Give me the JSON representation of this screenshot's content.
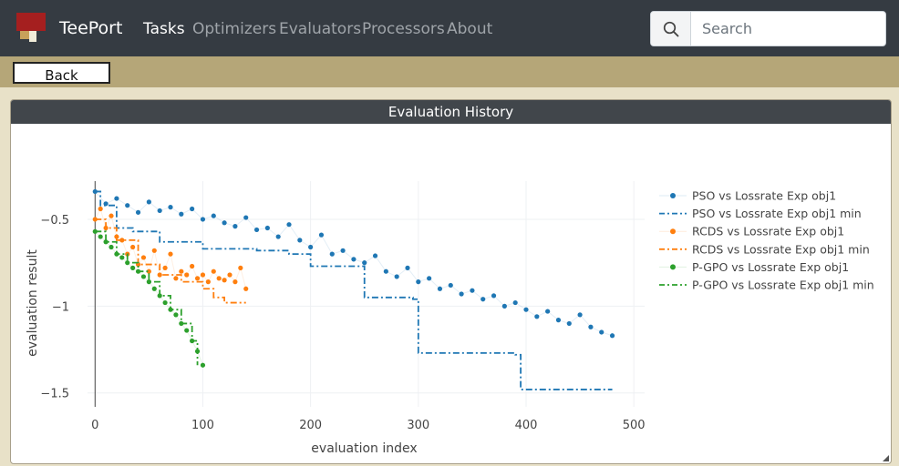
{
  "brand": "TeePort",
  "nav": [
    {
      "label": "Tasks",
      "active": true
    },
    {
      "label": "Optimizers",
      "active": false
    },
    {
      "label": "Evaluators",
      "active": false
    },
    {
      "label": "Processors",
      "active": false
    },
    {
      "label": "About",
      "active": false
    }
  ],
  "search": {
    "placeholder": "Search",
    "icon": "search-icon"
  },
  "back_button": {
    "label": "Back"
  },
  "panel": {
    "title": "Evaluation History"
  },
  "colors": {
    "navbar": "#353b42",
    "accent_strip": "#b5a678",
    "pso": "#1f77b4",
    "rcds": "#ff7f0e",
    "pgpo": "#2ca02c"
  },
  "chart_data": {
    "type": "scatter",
    "xlabel": "evaluation index",
    "ylabel": "evaluation result",
    "xlim": [
      -7,
      510
    ],
    "ylim": [
      -1.58,
      -0.28
    ],
    "x_ticks": [
      0,
      100,
      200,
      300,
      400,
      500
    ],
    "y_ticks": [
      -0.5,
      -1,
      -1.5
    ],
    "x_tick_labels": [
      "0",
      "100",
      "200",
      "300",
      "400",
      "500"
    ],
    "y_tick_labels": [
      "−0.5",
      "−1",
      "−1.5"
    ],
    "grid": true,
    "legend_position": "right",
    "series": [
      {
        "name": "PSO vs Lossrate Exp obj1",
        "style": "markers",
        "color": "#1f77b4",
        "x": [
          0,
          10,
          20,
          30,
          40,
          50,
          60,
          70,
          80,
          90,
          100,
          110,
          120,
          130,
          140,
          150,
          160,
          170,
          180,
          190,
          200,
          210,
          220,
          230,
          240,
          250,
          260,
          270,
          280,
          290,
          300,
          310,
          320,
          330,
          340,
          350,
          360,
          370,
          380,
          390,
          400,
          410,
          420,
          430,
          440,
          450,
          460,
          470,
          480
        ],
        "y": [
          -0.34,
          -0.41,
          -0.38,
          -0.42,
          -0.46,
          -0.4,
          -0.45,
          -0.43,
          -0.47,
          -0.44,
          -0.5,
          -0.48,
          -0.52,
          -0.54,
          -0.49,
          -0.56,
          -0.55,
          -0.6,
          -0.53,
          -0.62,
          -0.66,
          -0.59,
          -0.7,
          -0.68,
          -0.73,
          -0.75,
          -0.71,
          -0.8,
          -0.83,
          -0.78,
          -0.86,
          -0.84,
          -0.9,
          -0.88,
          -0.93,
          -0.91,
          -0.96,
          -0.94,
          -1.0,
          -0.98,
          -1.02,
          -1.06,
          -1.03,
          -1.08,
          -1.1,
          -1.05,
          -1.12,
          -1.15,
          -1.17
        ]
      },
      {
        "name": "PSO vs Lossrate Exp obj1 min",
        "style": "dash-dot-step",
        "color": "#1f77b4",
        "x": [
          0,
          5,
          20,
          35,
          60,
          100,
          150,
          180,
          200,
          250,
          295,
          300,
          390,
          395,
          480
        ],
        "y": [
          -0.34,
          -0.42,
          -0.55,
          -0.57,
          -0.63,
          -0.67,
          -0.68,
          -0.7,
          -0.77,
          -0.95,
          -0.96,
          -1.27,
          -1.28,
          -1.48,
          -1.48
        ]
      },
      {
        "name": "RCDS vs Lossrate Exp obj1",
        "style": "markers",
        "color": "#ff7f0e",
        "x": [
          0,
          5,
          10,
          15,
          20,
          25,
          30,
          35,
          40,
          45,
          50,
          55,
          60,
          65,
          70,
          75,
          80,
          85,
          90,
          95,
          100,
          105,
          110,
          115,
          120,
          125,
          130,
          135,
          140
        ],
        "y": [
          -0.5,
          -0.44,
          -0.55,
          -0.48,
          -0.6,
          -0.62,
          -0.7,
          -0.66,
          -0.76,
          -0.72,
          -0.8,
          -0.68,
          -0.82,
          -0.78,
          -0.7,
          -0.84,
          -0.8,
          -0.82,
          -0.77,
          -0.84,
          -0.82,
          -0.86,
          -0.8,
          -0.84,
          -0.85,
          -0.82,
          -0.86,
          -0.78,
          -0.9
        ]
      },
      {
        "name": "RCDS vs Lossrate Exp obj1 min",
        "style": "dash-dot-step",
        "color": "#ff7f0e",
        "x": [
          0,
          10,
          20,
          40,
          60,
          80,
          100,
          110,
          120,
          140
        ],
        "y": [
          -0.5,
          -0.55,
          -0.62,
          -0.76,
          -0.82,
          -0.86,
          -0.9,
          -0.95,
          -0.98,
          -0.98
        ]
      },
      {
        "name": "P-GPO vs Lossrate Exp obj1",
        "style": "markers",
        "color": "#2ca02c",
        "x": [
          0,
          5,
          10,
          15,
          20,
          25,
          30,
          35,
          40,
          45,
          50,
          55,
          60,
          65,
          70,
          75,
          80,
          85,
          90,
          95,
          100
        ],
        "y": [
          -0.57,
          -0.6,
          -0.63,
          -0.66,
          -0.7,
          -0.72,
          -0.75,
          -0.78,
          -0.8,
          -0.83,
          -0.86,
          -0.9,
          -0.94,
          -0.98,
          -1.02,
          -1.05,
          -1.1,
          -1.14,
          -1.2,
          -1.26,
          -1.34
        ]
      },
      {
        "name": "P-GPO vs Lossrate Exp obj1 min",
        "style": "dash-dot-step",
        "color": "#2ca02c",
        "x": [
          0,
          10,
          20,
          30,
          40,
          50,
          60,
          70,
          80,
          90,
          95
        ],
        "y": [
          -0.57,
          -0.63,
          -0.7,
          -0.75,
          -0.8,
          -0.86,
          -0.94,
          -1.02,
          -1.1,
          -1.2,
          -1.34
        ]
      }
    ]
  }
}
